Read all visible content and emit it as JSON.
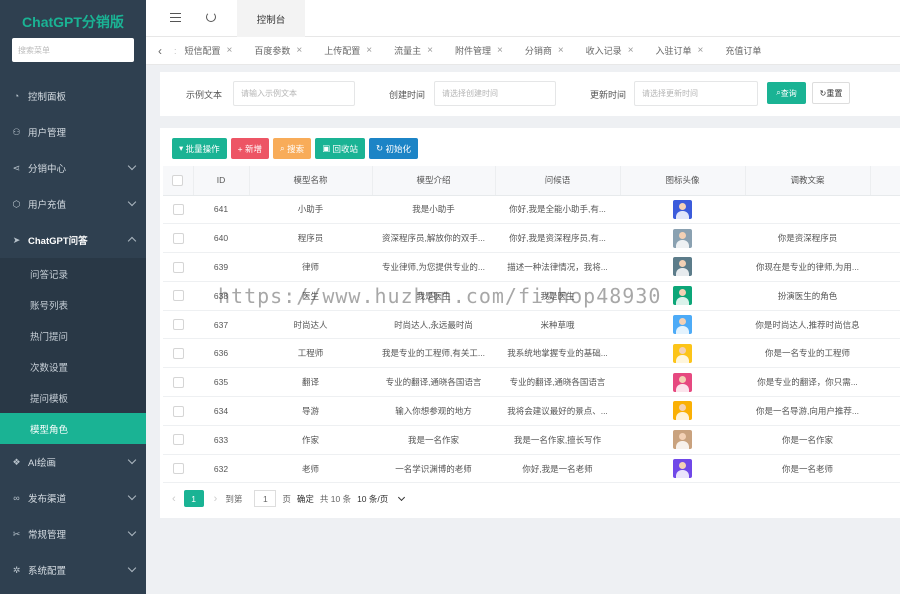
{
  "sidebar": {
    "logo": "ChatGPT分销版",
    "search_placeholder": "搜索菜单",
    "items": [
      {
        "label": "控制面板",
        "icon": "dashboard-icon"
      },
      {
        "label": "用户管理",
        "icon": "user-icon"
      },
      {
        "label": "分销中心",
        "icon": "share-icon"
      },
      {
        "label": "用户充值",
        "icon": "cube-icon"
      },
      {
        "label": "ChatGPT问答",
        "icon": "send-icon"
      }
    ],
    "sub_items": [
      {
        "label": "问答记录"
      },
      {
        "label": "账号列表"
      },
      {
        "label": "热门提问"
      },
      {
        "label": "次数设置"
      },
      {
        "label": "提问模板"
      },
      {
        "label": "模型角色"
      }
    ],
    "items_after": [
      {
        "label": "AI绘画",
        "icon": "palette-icon"
      },
      {
        "label": "发布渠道",
        "icon": "link-icon"
      },
      {
        "label": "常规管理",
        "icon": "tools-icon"
      },
      {
        "label": "系统配置",
        "icon": "gear-icon"
      }
    ]
  },
  "topbar": {
    "active_tab": "控制台"
  },
  "tabs": [
    "短信配置",
    "百度参数",
    "上传配置",
    "流量主",
    "附件管理",
    "分销商",
    "收入记录",
    "入驻订单",
    "充值订单"
  ],
  "filter": {
    "label1": "示例文本",
    "placeholder1": "请输入示例文本",
    "label2": "创建时间",
    "placeholder2": "请选择创建时间",
    "label3": "更新时间",
    "placeholder3": "请选择更新时间",
    "search": "查询",
    "reset": "重置"
  },
  "actions": {
    "batch": "批量操作",
    "add": "+ 新增",
    "search": "搜索",
    "recycle": "回收站",
    "init": "初始化",
    "colors": {
      "batch": "#1ab394",
      "add": "#ed5565",
      "search": "#f8ac59",
      "recycle": "#1ab394",
      "init": "#1c84c6"
    }
  },
  "table": {
    "headers": [
      "ID",
      "模型名称",
      "模型介绍",
      "问候语",
      "图标头像",
      "调教文案"
    ],
    "rows": [
      {
        "id": "641",
        "name": "小助手",
        "intro": "我是小助手",
        "greet": "你好,我是全能小助手,有...",
        "avatar": "#3b5bdb",
        "prompt": ""
      },
      {
        "id": "640",
        "name": "程序员",
        "intro": "资深程序员,解放你的双手...",
        "greet": "你好,我是资深程序员,有...",
        "avatar": "#8aa1b1",
        "prompt": "你是资深程序员"
      },
      {
        "id": "639",
        "name": "律师",
        "intro": "专业律师,为您提供专业的...",
        "greet": "描述一种法律情况，我将...",
        "avatar": "#5c7c8a",
        "prompt": "你现在是专业的律师,为用..."
      },
      {
        "id": "638",
        "name": "医生",
        "intro": "我是医生",
        "greet": "我是医生",
        "avatar": "#0ca678",
        "prompt": "扮演医生的角色"
      },
      {
        "id": "637",
        "name": "时尚达人",
        "intro": "时尚达人,永远最时尚",
        "greet": "米种草哦",
        "avatar": "#4dabf7",
        "prompt": "你是时尚达人,推荐时尚信息"
      },
      {
        "id": "636",
        "name": "工程师",
        "intro": "我是专业的工程师,有关工...",
        "greet": "我系统地掌握专业的基础...",
        "avatar": "#fcc419",
        "prompt": "你是一名专业的工程师"
      },
      {
        "id": "635",
        "name": "翻译",
        "intro": "专业的翻译,通晓各国语言",
        "greet": "专业的翻译,通晓各国语言",
        "avatar": "#e64980",
        "prompt": "你是专业的翻译，你只需..."
      },
      {
        "id": "634",
        "name": "导游",
        "intro": "输入你想参观的地方",
        "greet": "我将会建议最好的景点、...",
        "avatar": "#fab005",
        "prompt": "你是一名导游,向用户推荐..."
      },
      {
        "id": "633",
        "name": "作家",
        "intro": "我是一名作家",
        "greet": "我是一名作家,擅长写作",
        "avatar": "#c9a27e",
        "prompt": "你是一名作家"
      },
      {
        "id": "632",
        "name": "老师",
        "intro": "一名学识渊博的老师",
        "greet": "你好,我是一名老师",
        "avatar": "#7048e8",
        "prompt": "你是一名老师"
      }
    ]
  },
  "pager": {
    "page": "1",
    "goto_label": "到第",
    "goto_value": "1",
    "page_unit": "页",
    "confirm": "确定",
    "total": "共 10 条",
    "size": "10 条/页"
  },
  "watermark": "https://www.huzhan.com/fishop48930"
}
